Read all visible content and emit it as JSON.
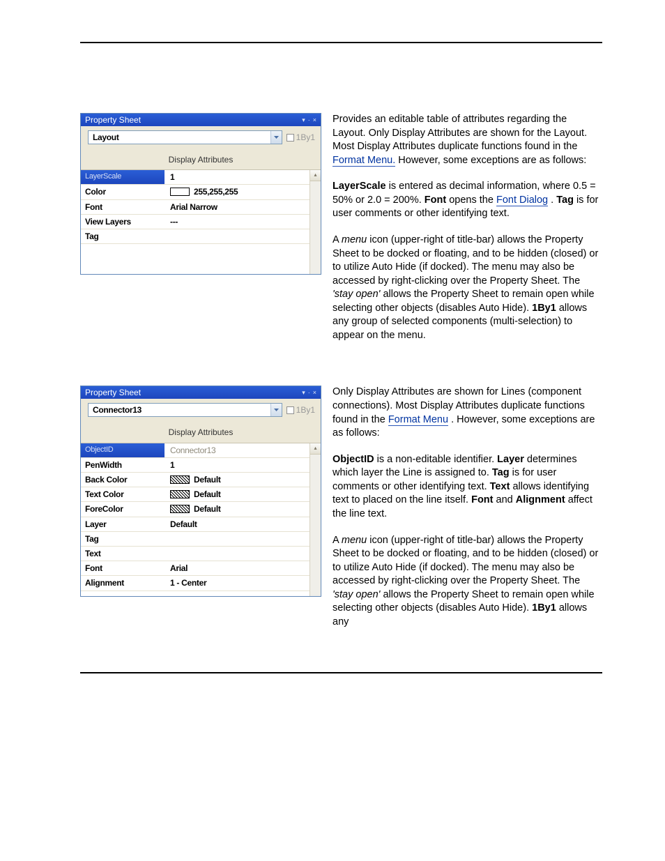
{
  "panel1": {
    "title": "Property Sheet",
    "combo_value": "Layout",
    "checkbox_label": "1By1",
    "tab_header": "Display Attributes",
    "rows": [
      {
        "label": "LayerScale",
        "value": "1"
      },
      {
        "label": "Color",
        "value": "255,255,255"
      },
      {
        "label": "Font",
        "value": "Arial Narrow"
      },
      {
        "label": "View Layers",
        "value": "---"
      },
      {
        "label": "Tag",
        "value": ""
      }
    ]
  },
  "panel2": {
    "title": "Property Sheet",
    "combo_value": "Connector13",
    "checkbox_label": "1By1",
    "tab_header": "Display Attributes",
    "rows": [
      {
        "label": "ObjectID",
        "value": "Connector13"
      },
      {
        "label": "PenWidth",
        "value": "1"
      },
      {
        "label": "Back Color",
        "value": "Default"
      },
      {
        "label": "Text Color",
        "value": "Default"
      },
      {
        "label": "ForeColor",
        "value": "Default"
      },
      {
        "label": "Layer",
        "value": "Default"
      },
      {
        "label": "Tag",
        "value": ""
      },
      {
        "label": "Text",
        "value": ""
      },
      {
        "label": "Font",
        "value": "Arial"
      },
      {
        "label": "Alignment",
        "value": "1 - Center"
      }
    ]
  },
  "desc1": {
    "p1a": "Provides an editable table of attributes regarding the Layout. Only Display Attributes are shown for the Layout. Most Display Attributes duplicate functions found in the ",
    "link1": "Format Menu.",
    "p1b": " However, some exceptions are as follows:",
    "p2a": "",
    "t_LayerScale": "LayerScale",
    "p2b": " is entered as decimal information, where 0.5 = 50% or 2.0 = 200%. ",
    "t_Font": "Font",
    "p2c": " opens the ",
    "link2": "Font Dialog",
    "p2d": ". ",
    "t_Tag": "Tag",
    "p2e": " is for user comments or other identifying text.",
    "p3a": "A ",
    "t_menu": "menu",
    "p3b": " icon (upper-right of title-bar) allows the Property Sheet to be docked or floating, and to be hidden (closed) or to utilize Auto Hide (if docked). The menu may also be accessed by right-clicking over the Property Sheet. The ",
    "t_stayopen": "'stay open'",
    "p3c": " allows the Property Sheet to remain open while selecting other objects (disables Auto Hide). ",
    "t_1by1": "1By1",
    "p3d": " allows any group of selected components (multi-selection) to appear on the menu."
  },
  "desc2": {
    "p1a": "Only Display Attributes are shown for Lines (component connections). Most Display Attributes duplicate functions found in the ",
    "link1": "Format Menu",
    "p1b": ". However, some exceptions are as follows:",
    "t_ObjectID": "ObjectID",
    "p2a": " is a non-editable identifier. ",
    "t_Layer": "Layer",
    "p2b": " determines which layer the Line is assigned to. ",
    "t_Tag": "Tag",
    "p2c": " is for user comments or other identifying text. ",
    "t_Text": "Text",
    "p2d": " allows identifying text to placed on the line itself. ",
    "t_Font": "Font",
    "p2e": " and ",
    "t_Alignment": "Alignment",
    "p2f": " affect the line text.",
    "p3a": "A ",
    "t_menu": "menu",
    "p3b": " icon (upper-right of title-bar) allows the Property Sheet to be docked or floating, and to be hidden (closed) or to utilize Auto Hide (if docked). The menu may also be accessed by right-clicking over the Property Sheet. The ",
    "t_stayopen": "'stay open'",
    "p3c": " allows the Property Sheet to remain open while selecting other objects (disables Auto Hide). ",
    "t_1by1": "1By1",
    "p3d": " allows any"
  }
}
